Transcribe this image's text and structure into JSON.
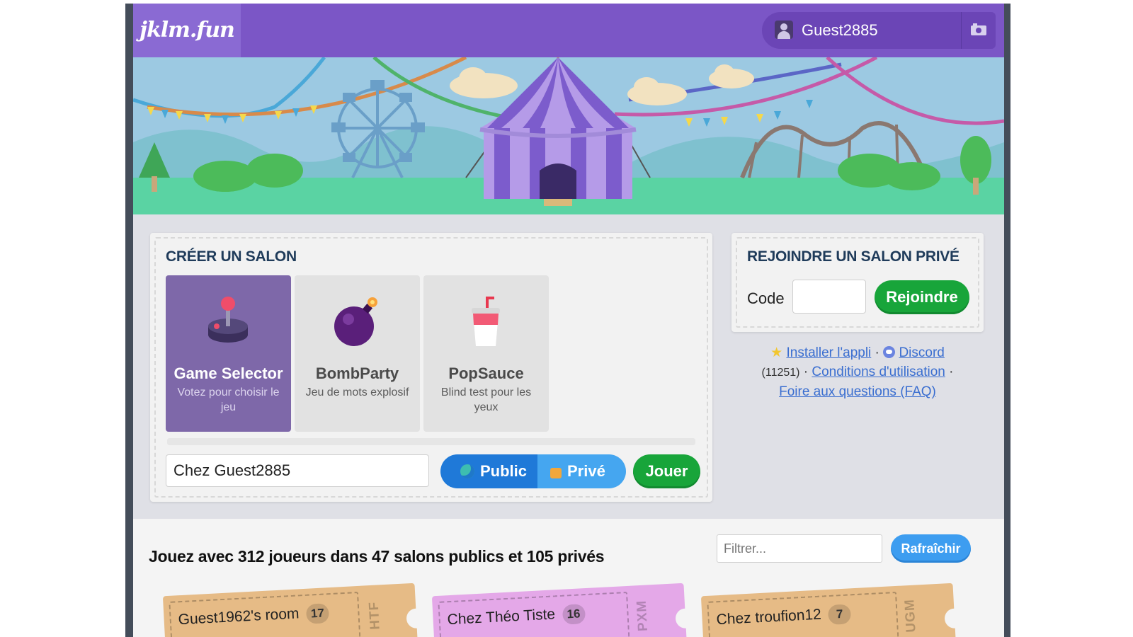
{
  "header": {
    "logo_text": "jklm.fun",
    "username": "Guest2885"
  },
  "create": {
    "title": "CRÉER UN SALON",
    "games": [
      {
        "name": "Game Selector",
        "desc": "Votez pour choisir le jeu",
        "icon": "joystick-icon"
      },
      {
        "name": "BombParty",
        "desc": "Jeu de mots explosif",
        "icon": "bomb-icon"
      },
      {
        "name": "PopSauce",
        "desc": "Blind test pour les yeux",
        "icon": "soda-cup-icon"
      }
    ],
    "room_name_value": "Chez Guest2885",
    "public_label": "Public",
    "private_label": "Privé",
    "play_label": "Jouer"
  },
  "join": {
    "title": "REJOINDRE UN SALON PRIVÉ",
    "code_label": "Code",
    "join_label": "Rejoindre"
  },
  "links": {
    "install_app": "Installer l'appli",
    "discord": "Discord",
    "count": "(11251)",
    "terms": "Conditions d'utilisation",
    "faq": "Foire aux questions (FAQ)"
  },
  "lobby": {
    "summary": "Jouez avec 312 joueurs dans 47 salons publics et 105 privés",
    "filter_placeholder": "Filtrer...",
    "refresh_label": "Rafraîchir",
    "rooms": [
      {
        "name": "Guest1962's room",
        "players": "17",
        "code": "HTF",
        "color": "#e6bb86"
      },
      {
        "name": "Chez Théo Tiste",
        "players": "16",
        "code": "PXM",
        "color": "#e4a8e8"
      },
      {
        "name": "Chez troufion12",
        "players": "7",
        "code": "UGM",
        "color": "#e6bb86"
      }
    ]
  },
  "colors": {
    "header_purple": "#7b56c6",
    "selected_card": "#7e68a9",
    "play_green": "#18a53a",
    "public_blue": "#1f79d8",
    "refresh_blue": "#3d9df0",
    "title_navy": "#1f3b5a"
  }
}
